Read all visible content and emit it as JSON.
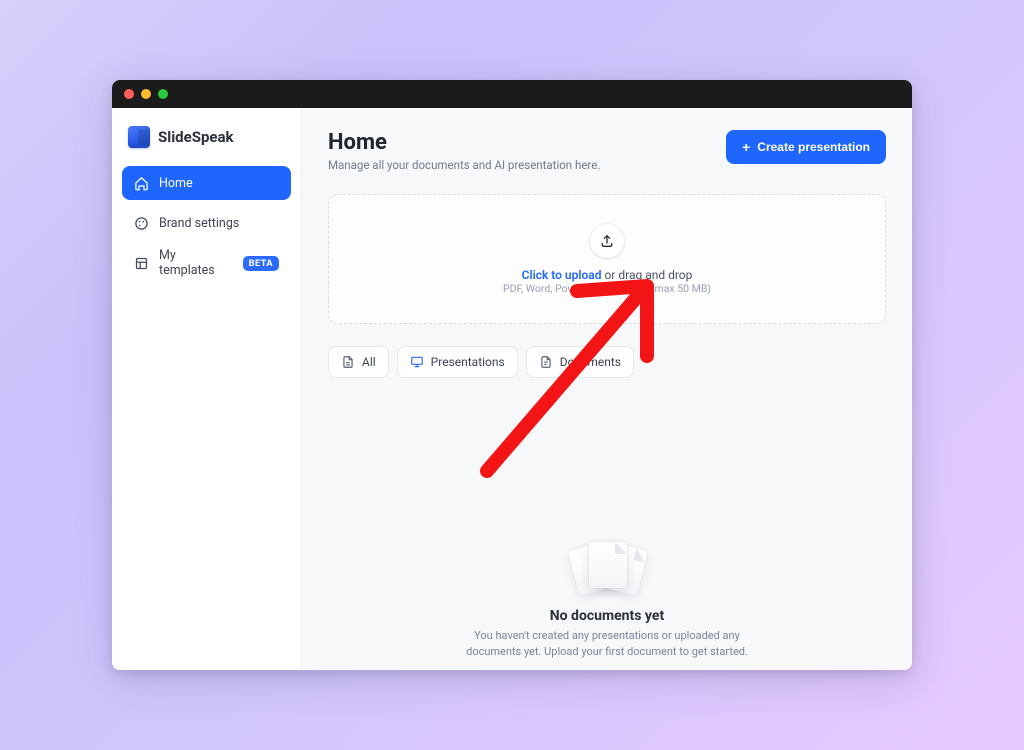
{
  "brand": {
    "name": "SlideSpeak"
  },
  "sidebar": {
    "items": [
      {
        "label": "Home"
      },
      {
        "label": "Brand settings"
      },
      {
        "label": "My templates",
        "badge": "BETA"
      }
    ]
  },
  "header": {
    "title": "Home",
    "subtitle": "Manage all your documents and AI presentation here.",
    "create_label": "Create presentation"
  },
  "dropzone": {
    "link": "Click to upload",
    "rest": " or drag and drop",
    "hint": "PDF, Word, PowerPoint or Excel (max 50 MB)"
  },
  "tabs": [
    {
      "label": "All"
    },
    {
      "label": "Presentations"
    },
    {
      "label": "Documents"
    }
  ],
  "empty": {
    "title": "No documents yet",
    "desc": "You haven't created any presentations or uploaded any documents yet. Upload your first document to get started."
  }
}
